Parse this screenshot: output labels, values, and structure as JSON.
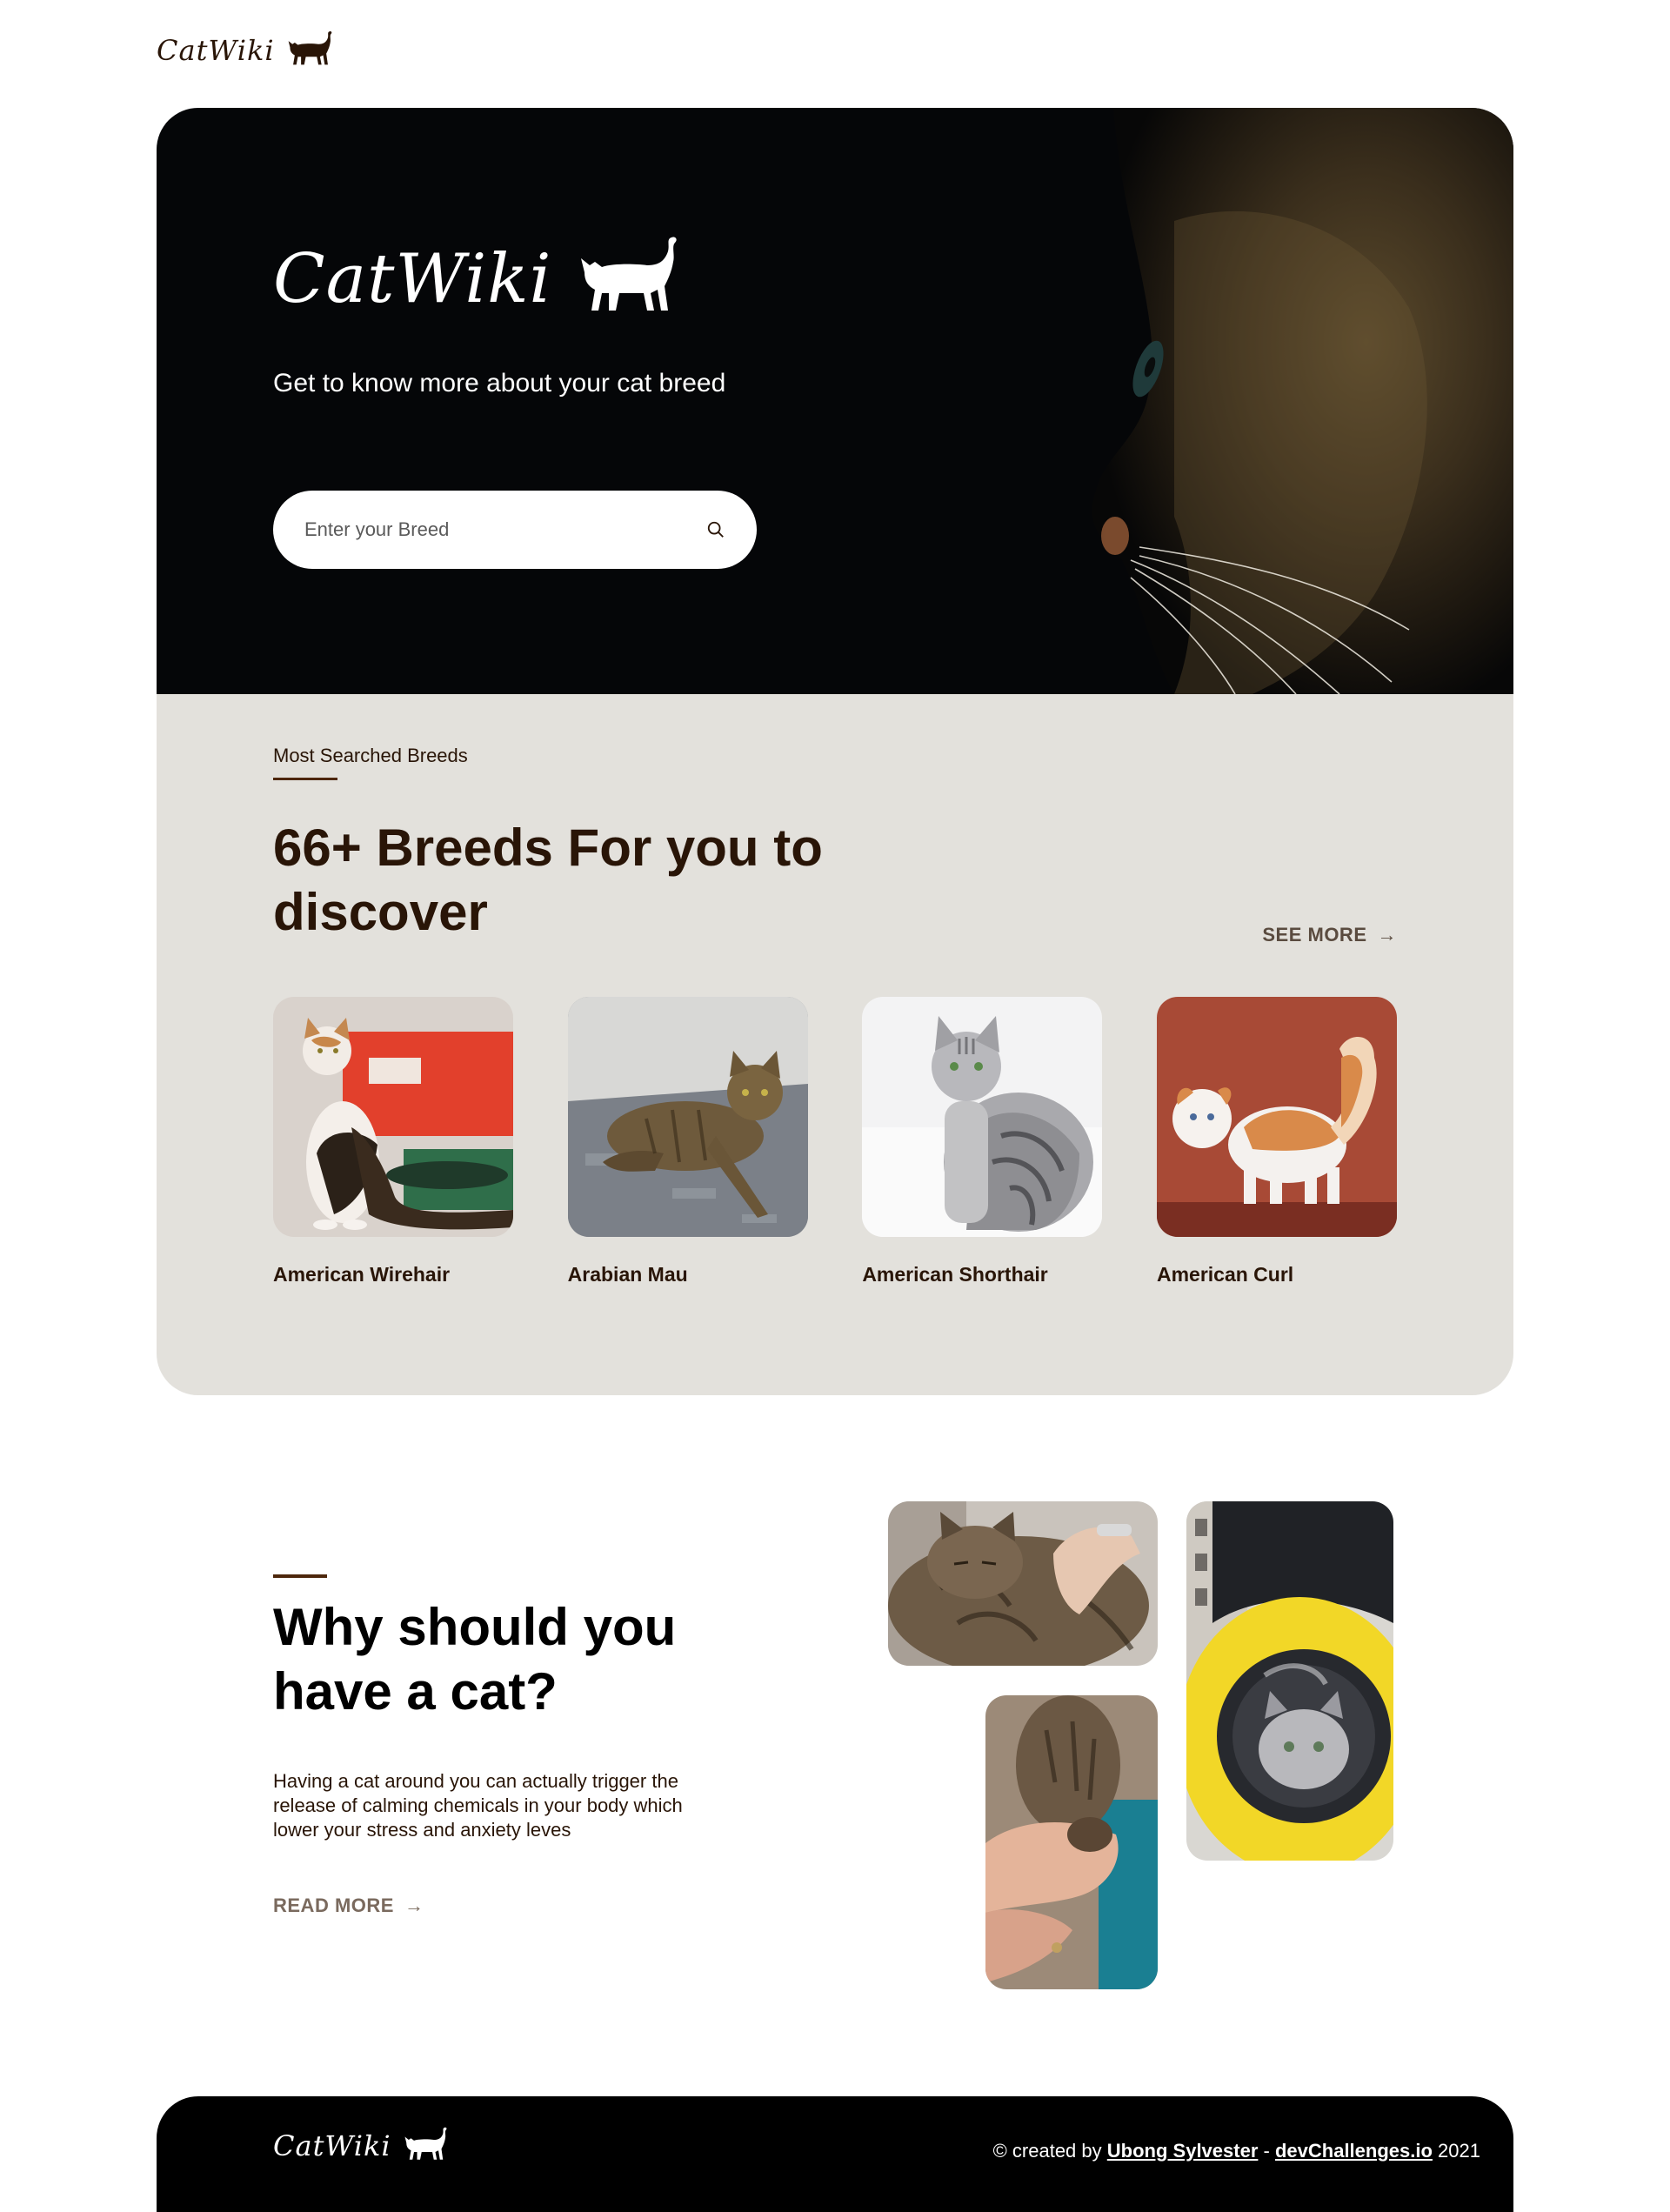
{
  "header": {
    "logo_text": "CatWiki",
    "logo_icon": "cat-silhouette-icon"
  },
  "hero": {
    "logo_text": "CatWiki",
    "tagline": "Get to know more about your cat breed",
    "search": {
      "placeholder": "Enter your Breed",
      "value": "",
      "icon": "search-icon"
    }
  },
  "breeds": {
    "label": "Most Searched Breeds",
    "title": "66+ Breeds For you to discover",
    "see_more": "SEE MORE",
    "items": [
      {
        "name": "American Wirehair"
      },
      {
        "name": "Arabian Mau"
      },
      {
        "name": "American Shorthair"
      },
      {
        "name": "American Curl"
      }
    ]
  },
  "why": {
    "title": "Why should you have a cat?",
    "text": "Having a cat around you can actually trigger the release of calming chemicals in your body which lower your stress and anxiety leves",
    "read_more": "READ MORE"
  },
  "footer": {
    "logo_text": "CatWiki",
    "credit_prefix": "© created by",
    "author": "Ubong Sylvester",
    "separator": "-",
    "site": "devChallenges.io",
    "year": "2021"
  },
  "colors": {
    "brand_dark": "#291507",
    "accent_line": "#4d270c",
    "breeds_bg": "#e3e1dc",
    "hero_bg": "#050608"
  }
}
